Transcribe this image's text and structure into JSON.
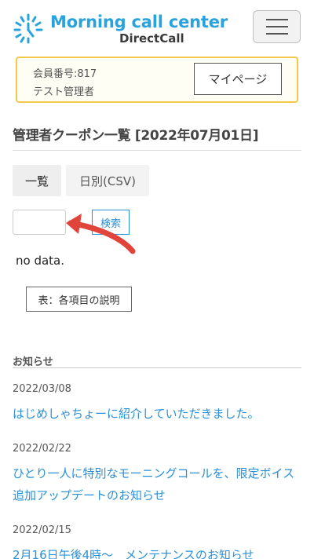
{
  "header": {
    "logo_title": "Morning call center",
    "logo_subtitle": "DirectCall",
    "brand_color": "#29a3dd"
  },
  "member": {
    "number_label": "会員番号:817",
    "name": "テスト管理者",
    "mypage_label": "マイページ"
  },
  "page": {
    "title": "管理者クーポン一覧 [2022年07月01日]"
  },
  "tabs": [
    {
      "label": "一覧"
    },
    {
      "label": "日別(CSV)"
    }
  ],
  "search": {
    "input_value": "",
    "button_label": "検索"
  },
  "results": {
    "empty_text": "no data.",
    "legend_button_label": "表：各項目の説明"
  },
  "news": {
    "heading": "お知らせ",
    "items": [
      {
        "date": "2022/03/08",
        "title": "はじめしゃちょーに紹介していただきました。"
      },
      {
        "date": "2022/02/22",
        "title": "ひとり一人に特別なモーニングコールを、限定ボイス追加アップデートのお知らせ"
      },
      {
        "date": "2022/02/15",
        "title": "2月16日午後4時〜　メンテナンスのお知らせ"
      }
    ]
  },
  "colors": {
    "link": "#2b8fd6",
    "member_border": "#f2c94c",
    "annotation_arrow": "#e0443a"
  }
}
